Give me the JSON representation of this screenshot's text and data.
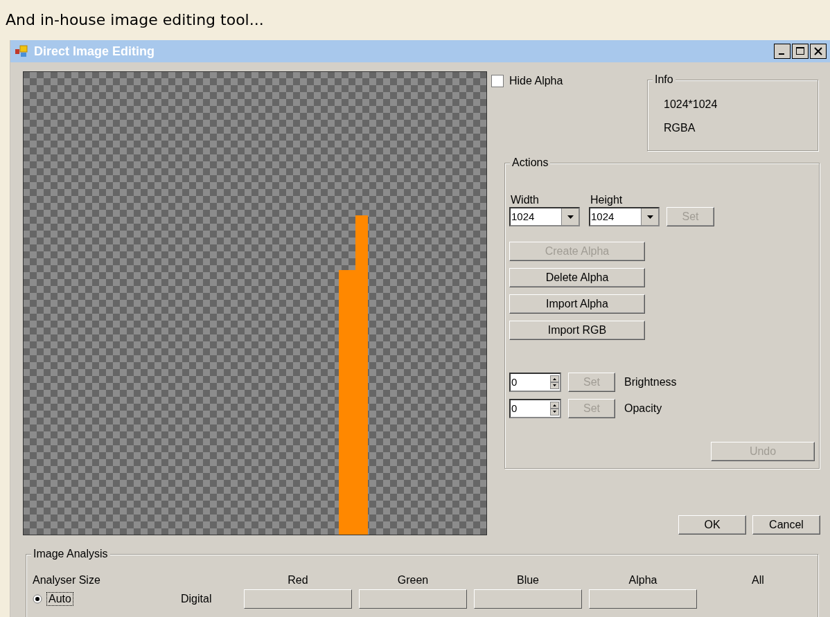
{
  "caption": "And in-house image editing tool...",
  "window": {
    "title": "Direct Image Editing"
  },
  "hide_alpha": {
    "label": "Hide Alpha",
    "checked": false
  },
  "info": {
    "title": "Info",
    "lines": [
      "1024*1024",
      "RGBA"
    ]
  },
  "actions": {
    "title": "Actions",
    "size_fields": [
      {
        "label": "Width",
        "value": "1024"
      },
      {
        "label": "Height",
        "value": "1024"
      }
    ],
    "set_button": {
      "label": "Set",
      "disabled": true
    },
    "buttons": [
      {
        "label": "Create Alpha",
        "disabled": true
      },
      {
        "label": "Delete Alpha",
        "disabled": false
      },
      {
        "label": "Import Alpha",
        "disabled": false
      },
      {
        "label": "Import RGB",
        "disabled": false
      }
    ],
    "adjustments": [
      {
        "value": "0",
        "button": "Set",
        "button_disabled": true,
        "label": "Brightness"
      },
      {
        "value": "0",
        "button": "Set",
        "button_disabled": true,
        "label": "Opacity"
      }
    ],
    "undo": {
      "label": "Undo",
      "disabled": true
    }
  },
  "dialog_buttons": [
    {
      "label": "OK",
      "disabled": false
    },
    {
      "label": "Cancel",
      "disabled": false
    }
  ],
  "analysis": {
    "title": "Image Analysis",
    "size_label": "Analyser Size",
    "sizes": [
      {
        "label": "Auto",
        "selected": true
      }
    ],
    "row_label": "Digital",
    "channels": [
      {
        "name": "Red",
        "kind": "bar"
      },
      {
        "name": "Green",
        "kind": "bar"
      },
      {
        "name": "Blue",
        "kind": "bar"
      },
      {
        "name": "Alpha",
        "kind": "bar"
      },
      {
        "name": "All",
        "kind": "plain"
      }
    ]
  }
}
